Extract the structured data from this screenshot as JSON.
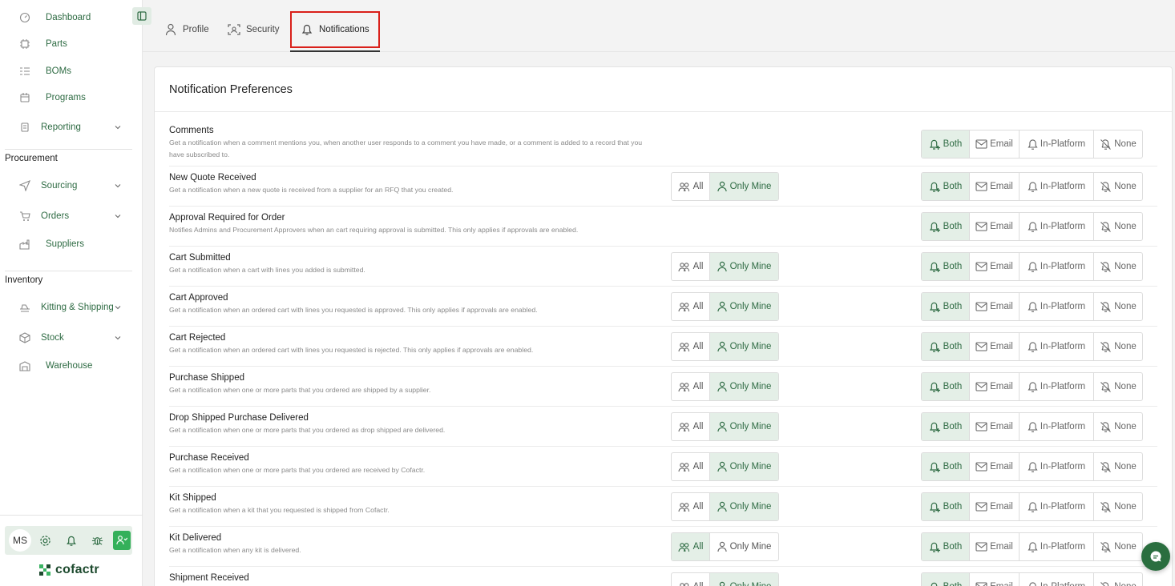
{
  "sidebar": {
    "items": [
      {
        "label": "Dashboard",
        "icon": "dashboard-icon"
      },
      {
        "label": "Parts",
        "icon": "chip-icon"
      },
      {
        "label": "BOMs",
        "icon": "list-icon"
      },
      {
        "label": "Programs",
        "icon": "calendar-icon"
      },
      {
        "label": "Reporting",
        "icon": "report-icon"
      },
      {
        "label": "Sourcing",
        "icon": "send-icon"
      },
      {
        "label": "Orders",
        "icon": "cart-icon"
      },
      {
        "label": "Suppliers",
        "icon": "factory-icon"
      },
      {
        "label": "Kitting & Shipping",
        "icon": "truck-icon"
      },
      {
        "label": "Stock",
        "icon": "box-icon"
      },
      {
        "label": "Warehouse",
        "icon": "warehouse-icon"
      }
    ],
    "sections": {
      "procurement": "Procurement",
      "inventory": "Inventory"
    },
    "avatar_initials": "MS",
    "logo_text": "cofactr"
  },
  "tabs": [
    {
      "label": "Profile",
      "icon": "user-icon"
    },
    {
      "label": "Security",
      "icon": "scan-face-icon"
    },
    {
      "label": "Notifications",
      "icon": "bell-icon",
      "active": true
    }
  ],
  "card": {
    "title": "Notification Preferences",
    "scope_options": {
      "all": "All",
      "mine": "Only Mine"
    },
    "channel_options": {
      "both": "Both",
      "email": "Email",
      "platform": "In-Platform",
      "none": "None"
    },
    "rows": [
      {
        "title": "Comments",
        "desc": "Get a notification when a comment mentions you, when another user responds to a comment you have made, or a comment is added to a record that you have subscribed to.",
        "scope": null,
        "channel": "both"
      },
      {
        "title": "New Quote Received",
        "desc": "Get a notification when a new quote is received from a supplier for an RFQ that you created.",
        "scope": "mine",
        "channel": "both"
      },
      {
        "title": "Approval Required for Order",
        "desc": "Notifies Admins and Procurement Approvers when an cart requiring approval is submitted. This only applies if approvals are enabled.",
        "scope": null,
        "channel": "both"
      },
      {
        "title": "Cart Submitted",
        "desc": "Get a notification when a cart with lines you added is submitted.",
        "scope": "mine",
        "channel": "both"
      },
      {
        "title": "Cart Approved",
        "desc": "Get a notification when an ordered cart with lines you requested is approved. This only applies if approvals are enabled.",
        "scope": "mine",
        "channel": "both"
      },
      {
        "title": "Cart Rejected",
        "desc": "Get a notification when an ordered cart with lines you requested is rejected. This only applies if approvals are enabled.",
        "scope": "mine",
        "channel": "both"
      },
      {
        "title": "Purchase Shipped",
        "desc": "Get a notification when one or more parts that you ordered are shipped by a supplier.",
        "scope": "mine",
        "channel": "both"
      },
      {
        "title": "Drop Shipped Purchase Delivered",
        "desc": "Get a notification when one or more parts that you ordered as drop shipped are delivered.",
        "scope": "mine",
        "channel": "both"
      },
      {
        "title": "Purchase Received",
        "desc": "Get a notification when one or more parts that you ordered are received by Cofactr.",
        "scope": "mine",
        "channel": "both"
      },
      {
        "title": "Kit Shipped",
        "desc": "Get a notification when a kit that you requested is shipped from Cofactr.",
        "scope": "mine",
        "channel": "both"
      },
      {
        "title": "Kit Delivered",
        "desc": "Get a notification when any kit is delivered.",
        "scope": "all",
        "channel": "both"
      },
      {
        "title": "Shipment Received",
        "desc": "",
        "scope": "mine",
        "channel": "both"
      }
    ]
  }
}
